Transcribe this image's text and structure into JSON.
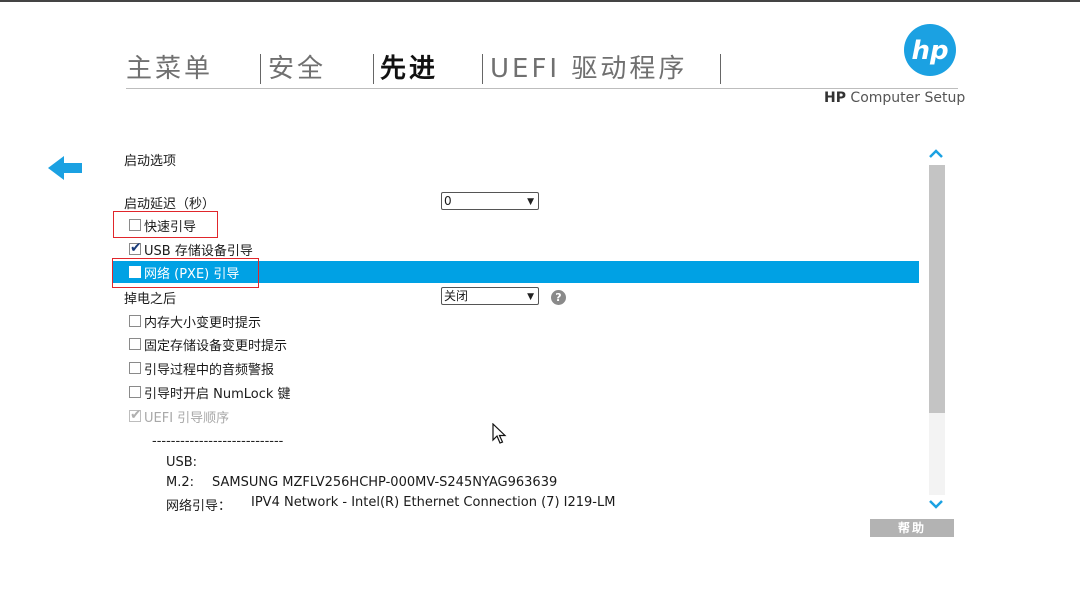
{
  "header": {
    "tabs": [
      {
        "label": "主菜单",
        "active": false
      },
      {
        "label": "安全",
        "active": false
      },
      {
        "label": "先进",
        "active": true
      },
      {
        "label": "UEFI 驱动程序",
        "active": false
      }
    ],
    "logo_text": "hp",
    "app_title_brand": "HP",
    "app_title_rest": " Computer Setup"
  },
  "section": {
    "title": "启动选项",
    "boot_delay": {
      "label": "启动延迟（秒）",
      "value": "0"
    },
    "options": [
      {
        "label": "快速引导",
        "checked": false,
        "disabled": false
      },
      {
        "label": "USB 存储设备引导",
        "checked": true,
        "disabled": false
      },
      {
        "label": "网络 (PXE) 引导",
        "checked": false,
        "disabled": false,
        "highlighted": true
      }
    ],
    "after_power_loss": {
      "label": "掉电之后",
      "value": "关闭"
    },
    "more_options": [
      {
        "label": "内存大小变更时提示",
        "checked": false,
        "disabled": false
      },
      {
        "label": "固定存储设备变更时提示",
        "checked": false,
        "disabled": false
      },
      {
        "label": "引导过程中的音频警报",
        "checked": false,
        "disabled": false
      },
      {
        "label": "引导时开启 NumLock 键",
        "checked": false,
        "disabled": false
      },
      {
        "label": "UEFI 引导顺序",
        "checked": true,
        "disabled": true
      }
    ]
  },
  "boot_order": {
    "separator": "----------------------------",
    "usb_label": "USB:",
    "m2_label": "M.2:",
    "m2_value": "SAMSUNG MZFLV256HCHP-000MV-S245NYAG963639",
    "net_label": "网络引导：",
    "net_value": "IPV4 Network - Intel(R) Ethernet Connection (7) I219-LM"
  },
  "help_button": "帮助",
  "help_q": "?",
  "check_glyph": "✔",
  "colors": {
    "accent": "#00a1e4",
    "logo": "#1ba1e2",
    "annotation": "#e0262b"
  }
}
